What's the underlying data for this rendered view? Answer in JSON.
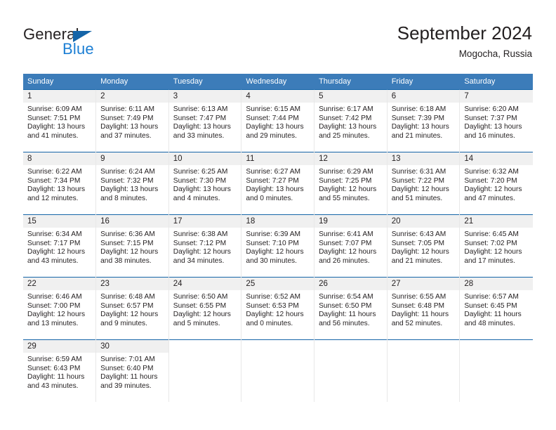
{
  "brand": {
    "name_part1": "General",
    "name_part2": "Blue",
    "logo_icon": "triangle-flag-icon"
  },
  "header": {
    "title": "September 2024",
    "location": "Mogocha, Russia"
  },
  "calendar": {
    "weekday_headers": [
      "Sunday",
      "Monday",
      "Tuesday",
      "Wednesday",
      "Thursday",
      "Friday",
      "Saturday"
    ],
    "header_bg": "#3c7cb9",
    "row_border": "#1565a8",
    "daynum_bg": "#f0f0f0",
    "weeks": [
      [
        {
          "day": "1",
          "sunrise": "Sunrise: 6:09 AM",
          "sunset": "Sunset: 7:51 PM",
          "daylight1": "Daylight: 13 hours",
          "daylight2": "and 41 minutes."
        },
        {
          "day": "2",
          "sunrise": "Sunrise: 6:11 AM",
          "sunset": "Sunset: 7:49 PM",
          "daylight1": "Daylight: 13 hours",
          "daylight2": "and 37 minutes."
        },
        {
          "day": "3",
          "sunrise": "Sunrise: 6:13 AM",
          "sunset": "Sunset: 7:47 PM",
          "daylight1": "Daylight: 13 hours",
          "daylight2": "and 33 minutes."
        },
        {
          "day": "4",
          "sunrise": "Sunrise: 6:15 AM",
          "sunset": "Sunset: 7:44 PM",
          "daylight1": "Daylight: 13 hours",
          "daylight2": "and 29 minutes."
        },
        {
          "day": "5",
          "sunrise": "Sunrise: 6:17 AM",
          "sunset": "Sunset: 7:42 PM",
          "daylight1": "Daylight: 13 hours",
          "daylight2": "and 25 minutes."
        },
        {
          "day": "6",
          "sunrise": "Sunrise: 6:18 AM",
          "sunset": "Sunset: 7:39 PM",
          "daylight1": "Daylight: 13 hours",
          "daylight2": "and 21 minutes."
        },
        {
          "day": "7",
          "sunrise": "Sunrise: 6:20 AM",
          "sunset": "Sunset: 7:37 PM",
          "daylight1": "Daylight: 13 hours",
          "daylight2": "and 16 minutes."
        }
      ],
      [
        {
          "day": "8",
          "sunrise": "Sunrise: 6:22 AM",
          "sunset": "Sunset: 7:34 PM",
          "daylight1": "Daylight: 13 hours",
          "daylight2": "and 12 minutes."
        },
        {
          "day": "9",
          "sunrise": "Sunrise: 6:24 AM",
          "sunset": "Sunset: 7:32 PM",
          "daylight1": "Daylight: 13 hours",
          "daylight2": "and 8 minutes."
        },
        {
          "day": "10",
          "sunrise": "Sunrise: 6:25 AM",
          "sunset": "Sunset: 7:30 PM",
          "daylight1": "Daylight: 13 hours",
          "daylight2": "and 4 minutes."
        },
        {
          "day": "11",
          "sunrise": "Sunrise: 6:27 AM",
          "sunset": "Sunset: 7:27 PM",
          "daylight1": "Daylight: 13 hours",
          "daylight2": "and 0 minutes."
        },
        {
          "day": "12",
          "sunrise": "Sunrise: 6:29 AM",
          "sunset": "Sunset: 7:25 PM",
          "daylight1": "Daylight: 12 hours",
          "daylight2": "and 55 minutes."
        },
        {
          "day": "13",
          "sunrise": "Sunrise: 6:31 AM",
          "sunset": "Sunset: 7:22 PM",
          "daylight1": "Daylight: 12 hours",
          "daylight2": "and 51 minutes."
        },
        {
          "day": "14",
          "sunrise": "Sunrise: 6:32 AM",
          "sunset": "Sunset: 7:20 PM",
          "daylight1": "Daylight: 12 hours",
          "daylight2": "and 47 minutes."
        }
      ],
      [
        {
          "day": "15",
          "sunrise": "Sunrise: 6:34 AM",
          "sunset": "Sunset: 7:17 PM",
          "daylight1": "Daylight: 12 hours",
          "daylight2": "and 43 minutes."
        },
        {
          "day": "16",
          "sunrise": "Sunrise: 6:36 AM",
          "sunset": "Sunset: 7:15 PM",
          "daylight1": "Daylight: 12 hours",
          "daylight2": "and 38 minutes."
        },
        {
          "day": "17",
          "sunrise": "Sunrise: 6:38 AM",
          "sunset": "Sunset: 7:12 PM",
          "daylight1": "Daylight: 12 hours",
          "daylight2": "and 34 minutes."
        },
        {
          "day": "18",
          "sunrise": "Sunrise: 6:39 AM",
          "sunset": "Sunset: 7:10 PM",
          "daylight1": "Daylight: 12 hours",
          "daylight2": "and 30 minutes."
        },
        {
          "day": "19",
          "sunrise": "Sunrise: 6:41 AM",
          "sunset": "Sunset: 7:07 PM",
          "daylight1": "Daylight: 12 hours",
          "daylight2": "and 26 minutes."
        },
        {
          "day": "20",
          "sunrise": "Sunrise: 6:43 AM",
          "sunset": "Sunset: 7:05 PM",
          "daylight1": "Daylight: 12 hours",
          "daylight2": "and 21 minutes."
        },
        {
          "day": "21",
          "sunrise": "Sunrise: 6:45 AM",
          "sunset": "Sunset: 7:02 PM",
          "daylight1": "Daylight: 12 hours",
          "daylight2": "and 17 minutes."
        }
      ],
      [
        {
          "day": "22",
          "sunrise": "Sunrise: 6:46 AM",
          "sunset": "Sunset: 7:00 PM",
          "daylight1": "Daylight: 12 hours",
          "daylight2": "and 13 minutes."
        },
        {
          "day": "23",
          "sunrise": "Sunrise: 6:48 AM",
          "sunset": "Sunset: 6:57 PM",
          "daylight1": "Daylight: 12 hours",
          "daylight2": "and 9 minutes."
        },
        {
          "day": "24",
          "sunrise": "Sunrise: 6:50 AM",
          "sunset": "Sunset: 6:55 PM",
          "daylight1": "Daylight: 12 hours",
          "daylight2": "and 5 minutes."
        },
        {
          "day": "25",
          "sunrise": "Sunrise: 6:52 AM",
          "sunset": "Sunset: 6:53 PM",
          "daylight1": "Daylight: 12 hours",
          "daylight2": "and 0 minutes."
        },
        {
          "day": "26",
          "sunrise": "Sunrise: 6:54 AM",
          "sunset": "Sunset: 6:50 PM",
          "daylight1": "Daylight: 11 hours",
          "daylight2": "and 56 minutes."
        },
        {
          "day": "27",
          "sunrise": "Sunrise: 6:55 AM",
          "sunset": "Sunset: 6:48 PM",
          "daylight1": "Daylight: 11 hours",
          "daylight2": "and 52 minutes."
        },
        {
          "day": "28",
          "sunrise": "Sunrise: 6:57 AM",
          "sunset": "Sunset: 6:45 PM",
          "daylight1": "Daylight: 11 hours",
          "daylight2": "and 48 minutes."
        }
      ],
      [
        {
          "day": "29",
          "sunrise": "Sunrise: 6:59 AM",
          "sunset": "Sunset: 6:43 PM",
          "daylight1": "Daylight: 11 hours",
          "daylight2": "and 43 minutes."
        },
        {
          "day": "30",
          "sunrise": "Sunrise: 7:01 AM",
          "sunset": "Sunset: 6:40 PM",
          "daylight1": "Daylight: 11 hours",
          "daylight2": "and 39 minutes."
        },
        {
          "day": "",
          "sunrise": "",
          "sunset": "",
          "daylight1": "",
          "daylight2": ""
        },
        {
          "day": "",
          "sunrise": "",
          "sunset": "",
          "daylight1": "",
          "daylight2": ""
        },
        {
          "day": "",
          "sunrise": "",
          "sunset": "",
          "daylight1": "",
          "daylight2": ""
        },
        {
          "day": "",
          "sunrise": "",
          "sunset": "",
          "daylight1": "",
          "daylight2": ""
        },
        {
          "day": "",
          "sunrise": "",
          "sunset": "",
          "daylight1": "",
          "daylight2": ""
        }
      ]
    ]
  }
}
